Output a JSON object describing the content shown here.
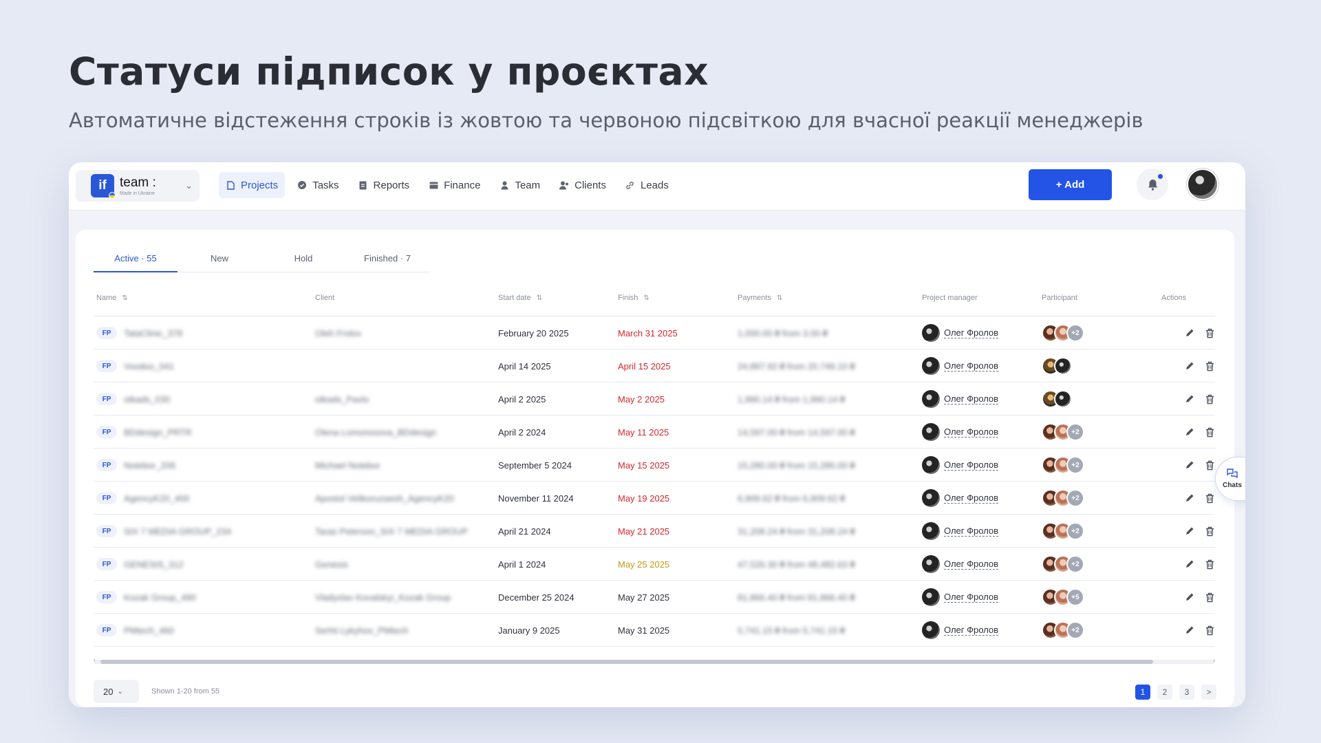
{
  "hero": {
    "title": "Статуси підписок у проєктах",
    "subtitle": "Автоматичне відстеження строків із жовтою та червоною підсвіткою для вчасної реакції менеджерів"
  },
  "workspace": {
    "logo": "if",
    "name": "team :",
    "tagline": "Made in Ukraine"
  },
  "nav": [
    {
      "label": "Projects",
      "icon": "file-icon",
      "active": true
    },
    {
      "label": "Tasks",
      "icon": "check-circle-icon",
      "active": false
    },
    {
      "label": "Reports",
      "icon": "report-icon",
      "active": false
    },
    {
      "label": "Finance",
      "icon": "wallet-icon",
      "active": false
    },
    {
      "label": "Team",
      "icon": "user-icon",
      "active": false
    },
    {
      "label": "Clients",
      "icon": "users-icon",
      "active": false
    },
    {
      "label": "Leads",
      "icon": "link-icon",
      "active": false
    }
  ],
  "add_button": "+ Add",
  "colors": {
    "accent": "#2354e6",
    "overdue_red": "#d8262a",
    "warning_yellow": "#c39a12"
  },
  "tabs": [
    {
      "label": "Active · 55",
      "active": true
    },
    {
      "label": "New",
      "active": false
    },
    {
      "label": "Hold",
      "active": false
    },
    {
      "label": "Finished · 7",
      "active": false
    }
  ],
  "columns": [
    "Name",
    "Client",
    "Start date",
    "Finish",
    "Payments",
    "Project manager",
    "Participant",
    "Actions"
  ],
  "rows": [
    {
      "badge": "FP",
      "name": "TataClinic_378",
      "client": "Oleh Frolov",
      "start": "February 20 2025",
      "finish": "March 31 2025",
      "finish_status": "red",
      "payment": "1,000.00 ₴ from 3.00 ₴",
      "pm": "Олег Фролов",
      "participants": [
        "a1",
        "a2"
      ],
      "more": "+2"
    },
    {
      "badge": "FP",
      "name": "Voodoo_041",
      "client": "",
      "start": "April 14 2025",
      "finish": "April 15 2025",
      "finish_status": "red",
      "payment": "24,897.92 ₴ from 20,749.10 ₴",
      "pm": "Олег Фролов",
      "participants": [
        "a4",
        "a3"
      ],
      "more": ""
    },
    {
      "badge": "FP",
      "name": "otkads_030",
      "client": "otkads_Pavlo",
      "start": "April 2 2025",
      "finish": "May 2 2025",
      "finish_status": "red",
      "payment": "1,990.14 ₴ from 1,990.14 ₴",
      "pm": "Олег Фролов",
      "participants": [
        "a4",
        "a3"
      ],
      "more": ""
    },
    {
      "badge": "FP",
      "name": "BDdesign_PRTR",
      "client": "Olena Lomonosova_BDdesign",
      "start": "April 2 2024",
      "finish": "May 11 2025",
      "finish_status": "red",
      "payment": "14,597.00 ₴ from 14,597.00 ₴",
      "pm": "Олег Фролов",
      "participants": [
        "a1",
        "a2"
      ],
      "more": "+2"
    },
    {
      "badge": "FP",
      "name": "Notebor_206",
      "client": "Michael Notebor",
      "start": "September 5 2024",
      "finish": "May 15 2025",
      "finish_status": "red",
      "payment": "15,280.00 ₴ from 15,280.00 ₴",
      "pm": "Олег Фролов",
      "participants": [
        "a1",
        "a2"
      ],
      "more": "+2"
    },
    {
      "badge": "FP",
      "name": "AgencyK20_400",
      "client": "Apostol Velikoruzaesh_AgencyK20",
      "start": "November 11 2024",
      "finish": "May 19 2025",
      "finish_status": "red",
      "payment": "6,909.62 ₴ from 6,909.62 ₴",
      "pm": "Олег Фролов",
      "participants": [
        "a1",
        "a2"
      ],
      "more": "+2"
    },
    {
      "badge": "FP",
      "name": "SIX 7 MEDIA GROUP_234",
      "client": "Taras Peterson_SIX 7 MEDIA GROUP",
      "start": "April 21 2024",
      "finish": "May 21 2025",
      "finish_status": "red",
      "payment": "31,208.24 ₴ from 31,208.24 ₴",
      "pm": "Олег Фролов",
      "participants": [
        "a1",
        "a2"
      ],
      "more": "+2"
    },
    {
      "badge": "FP",
      "name": "GENESIS_312",
      "client": "Genesis",
      "start": "April 1 2024",
      "finish": "May 25 2025",
      "finish_status": "yellow",
      "payment": "47,526.30 ₴ from 48,482.63 ₴",
      "pm": "Олег Фролов",
      "participants": [
        "a1",
        "a2"
      ],
      "more": "+2"
    },
    {
      "badge": "FP",
      "name": "Kozak Group_490",
      "client": "Vladyslav Kovalskyi_Kozak Group",
      "start": "December 25 2024",
      "finish": "May 27 2025",
      "finish_status": "normal",
      "payment": "81,866.40 ₴ from 81,866.40 ₴",
      "pm": "Олег Фролов",
      "participants": [
        "a1",
        "a2"
      ],
      "more": "+5"
    },
    {
      "badge": "FP",
      "name": "PMtech_460",
      "client": "Serhii Lykyhov_PMtech",
      "start": "January 9 2025",
      "finish": "May 31 2025",
      "finish_status": "normal",
      "payment": "5,741.15 ₴ from 5,741.15 ₴",
      "pm": "Олег Фролов",
      "participants": [
        "a1",
        "a2"
      ],
      "more": "+2"
    }
  ],
  "footer": {
    "page_size": "20",
    "shown": "Shown 1-20 from 55",
    "pages": [
      "1",
      "2",
      "3",
      ">"
    ],
    "current_page": "1"
  },
  "chats_label": "Chats"
}
